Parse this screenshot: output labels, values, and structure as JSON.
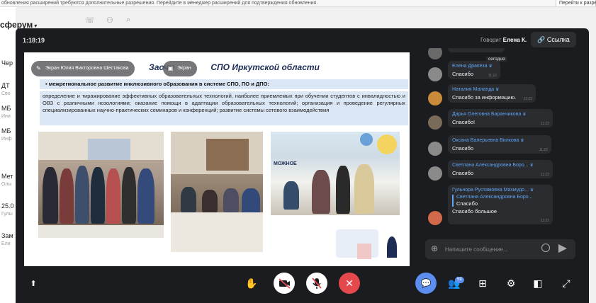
{
  "browser_notice": {
    "text": "обновления расширений требуются дополнительные разрешения. Перейдите в менеджер расширений для подтверждения обновления.",
    "button": "Перейти к разреш"
  },
  "sidebar": {
    "logo": "сферум",
    "items": [
      {
        "title": "Чер",
        "sub": ""
      },
      {
        "title": "ДТ",
        "sub": "Сво"
      },
      {
        "title": "МБ",
        "sub": "Ини"
      },
      {
        "title": "МБ",
        "sub": "Инф"
      },
      {
        "title": "Мет",
        "sub": "Олы"
      },
      {
        "title": "25.0",
        "sub": "Гулы"
      },
      {
        "title": "Зам",
        "sub": "Ели"
      }
    ]
  },
  "call": {
    "timer": "1:18:19",
    "speaker_prefix": "Говорит",
    "speaker_name": "Елена К.",
    "link_button": "Ссылка",
    "screen_share_label": "Экран Юлия Викторовна Шестакова",
    "second_pill_label": "Экран"
  },
  "slide": {
    "title": "Заочная ... СПО Иркутской области",
    "title_visible_start": "Заочн",
    "title_visible_end": "СПО Иркутской области",
    "bullet": "межрегиональное развитие инклюзивного образования в системе СПО, ПО и ДПО:",
    "body": "определение и тиражирование эффективных образовательных технологий, наиболее приемлемых при обучении студентов с инвалидностью и ОВЗ с различными нозологиями; оказание помощи в адаптации образовательных технологий; организация и проведение регулярных специализированных научно-практических семинаров и конференций; развитие системы сетевого взаимодействия",
    "photo3_caption": "МОЖНОЕ"
  },
  "chat": {
    "date_label": "сегодня",
    "messages": [
      {
        "name": "Елена Драпеза",
        "text": "Спасибо",
        "time": "11:22",
        "avatar_color": "#8a8a8a"
      },
      {
        "name": "Наталия Маланда",
        "text": "Спасибо за информацию.",
        "time": "11:22",
        "avatar_color": "#c98a3a"
      },
      {
        "name": "Дарья Олеговна Баранчикова",
        "text": "Спасибо!",
        "time": "11:22",
        "avatar_color": "#7a6a5a"
      },
      {
        "name": "Оксана Валерьевна Вилкова",
        "text": "Спасибо",
        "time": "11:22",
        "avatar_color": "#8a8a8a"
      },
      {
        "name": "Светлана Александровна Боро...",
        "text": "Спасибо",
        "time": "11:22",
        "avatar_color": "#8a8a8a"
      },
      {
        "name": "Гульнора Рустамовна Махмудо...",
        "reply_name": "Светлана Александровна Боро...",
        "reply_text": "Спасибо",
        "text": "Спасибо большое",
        "time": "11:22",
        "avatar_color": "#d06a4a"
      }
    ],
    "input_placeholder": "Напишите сообщение..."
  },
  "toolbar": {
    "participants_count": "58"
  },
  "colors": {
    "accent": "#5b8ef0",
    "end_call": "#e5484d",
    "overlay_bg": "#1b1c1f"
  }
}
